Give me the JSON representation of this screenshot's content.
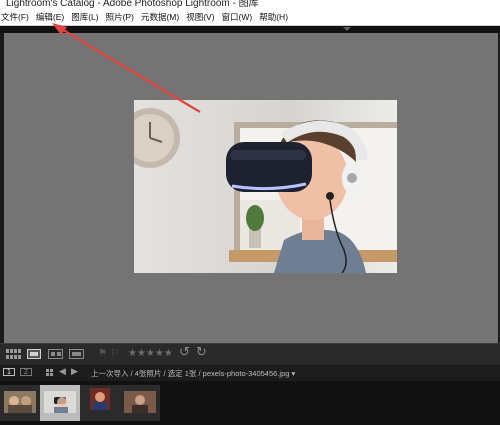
{
  "window": {
    "title": "Lightroom's Catalog - Adobe Photoshop Lightroom - 图库"
  },
  "menu": {
    "items": [
      {
        "label": "文件(F)"
      },
      {
        "label": "编辑(E)"
      },
      {
        "label": "图库(L)"
      },
      {
        "label": "照片(P)"
      },
      {
        "label": "元数据(M)"
      },
      {
        "label": "视图(V)"
      },
      {
        "label": "窗口(W)"
      },
      {
        "label": "帮助(H)"
      }
    ]
  },
  "toolbar": {
    "rating": "★★★★★",
    "rotate_left": "↺",
    "rotate_right": "↻"
  },
  "filmstrip_bar": {
    "monitor_1": "1",
    "monitor_2": "2",
    "path": "上一次导入 / 4张照片 / 选定 1张 / pexels-photo-3405456.jpg ▾"
  },
  "filmstrip": {
    "thumbnails": [
      {
        "name": "thumbnail-1",
        "selected": false
      },
      {
        "name": "thumbnail-2",
        "selected": true
      },
      {
        "name": "thumbnail-3",
        "selected": false
      },
      {
        "name": "thumbnail-4",
        "selected": false
      }
    ]
  },
  "annotation": {
    "arrow_color": "#e0453f"
  },
  "colors": {
    "loupe_background": "#747474",
    "panel_dark": "#111111"
  }
}
